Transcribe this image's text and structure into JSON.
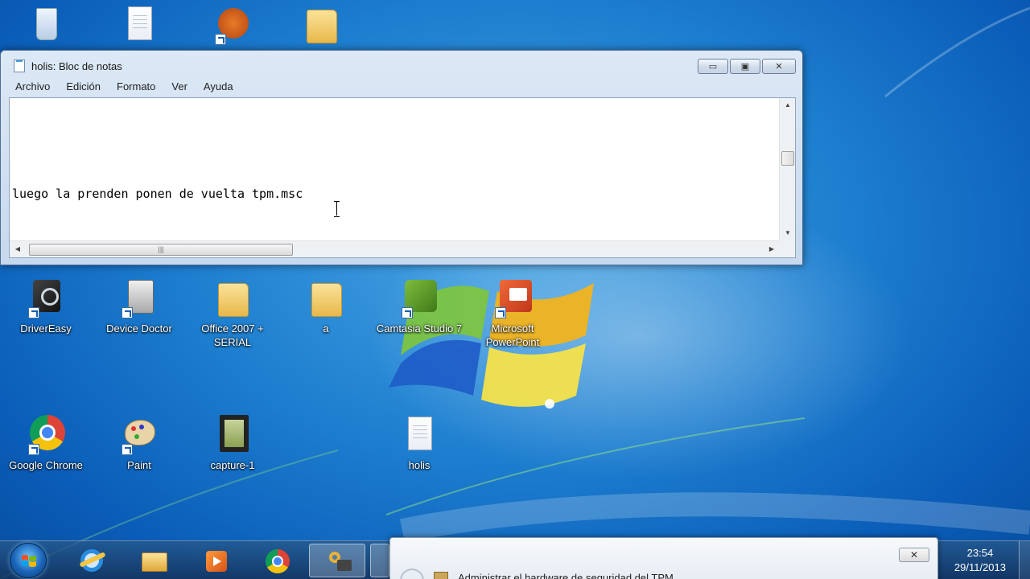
{
  "notepad": {
    "title": "holis: Bloc de notas",
    "menu": [
      "Archivo",
      "Edición",
      "Formato",
      "Ver",
      "Ayuda"
    ],
    "content": "luego la prenden ponen de vuelta tpm.msc",
    "buttons": {
      "minimize": "▭",
      "maximize": "▣",
      "close": "✕"
    }
  },
  "desktop": {
    "icons": [
      {
        "label": "DriverEasy",
        "icon": "drivereasy-icon"
      },
      {
        "label": "Device Doctor",
        "icon": "device-doctor-icon"
      },
      {
        "label": "Office 2007 + SERIAL",
        "icon": "folder-icon"
      },
      {
        "label": "a",
        "icon": "folder-icon"
      },
      {
        "label": "Camtasia Studio 7",
        "icon": "camtasia-icon"
      },
      {
        "label": "Microsoft PowerPoint",
        "icon": "powerpoint-icon"
      },
      {
        "label": "Google Chrome",
        "icon": "chrome-icon"
      },
      {
        "label": "Paint",
        "icon": "paint-icon"
      },
      {
        "label": "capture-1",
        "icon": "video-file-icon"
      },
      {
        "label": "holis",
        "icon": "text-file-icon"
      }
    ]
  },
  "taskbar": {
    "pinned": [
      "internet-explorer-icon",
      "explorer-icon",
      "media-player-icon",
      "chrome-icon",
      "security-key-icon"
    ],
    "clock": {
      "time": "23:54",
      "date": "29/11/2013"
    }
  },
  "popup": {
    "text": "Administrar el hardware de seguridad del TPM",
    "close": "✕"
  },
  "colors": {
    "desktop_blue": "#1e7fd0",
    "titlebar": "#dce8f5",
    "taskbar": "#1e4a7a"
  }
}
